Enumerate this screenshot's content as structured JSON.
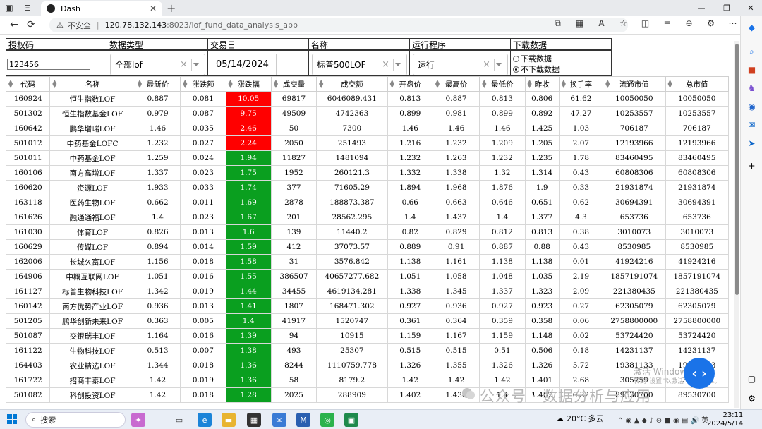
{
  "browser": {
    "tab_title": "Dash",
    "security_label": "不安全",
    "url_host": "120.78.132.143",
    "url_path": ":8023/lof_fund_data_analysis_app"
  },
  "controls": {
    "auth_label": "授权码",
    "auth_value": "123456",
    "datatype_label": "数据类型",
    "datatype_value": "全部lof",
    "date_label": "交易日",
    "date_value": "05/14/2024",
    "name_label": "名称",
    "name_value": "标普500LOF",
    "runner_label": "运行程序",
    "runner_value": "运行",
    "download_label": "下载数据",
    "download_options": [
      "下载数据",
      "不下载数据"
    ],
    "download_selected": "不下载数据"
  },
  "table": {
    "headers": [
      "代码",
      "名称",
      "最新价",
      "涨跌额",
      "涨跌幅",
      "成交量",
      "成交额",
      "开盘价",
      "最高价",
      "最低价",
      "昨收",
      "换手率",
      "流通市值",
      "总市值"
    ],
    "rows": [
      [
        "160924",
        "恒生指数LOF",
        "0.887",
        "0.081",
        "10.05",
        "69817",
        "6046089.431",
        "0.813",
        "0.887",
        "0.813",
        "0.806",
        "61.62",
        "10050050",
        "10050050"
      ],
      [
        "501302",
        "恒生指数基金LOF",
        "0.979",
        "0.087",
        "9.75",
        "49509",
        "4742363",
        "0.899",
        "0.981",
        "0.899",
        "0.892",
        "47.27",
        "10253557",
        "10253557"
      ],
      [
        "160642",
        "鹏华增瑞LOF",
        "1.46",
        "0.035",
        "2.46",
        "50",
        "7300",
        "1.46",
        "1.46",
        "1.46",
        "1.425",
        "1.03",
        "706187",
        "706187"
      ],
      [
        "501012",
        "中药基金LOFC",
        "1.232",
        "0.027",
        "2.24",
        "2050",
        "251493",
        "1.216",
        "1.232",
        "1.209",
        "1.205",
        "2.07",
        "12193966",
        "12193966"
      ],
      [
        "501011",
        "中药基金LOF",
        "1.259",
        "0.024",
        "1.94",
        "11827",
        "1481094",
        "1.232",
        "1.263",
        "1.232",
        "1.235",
        "1.78",
        "83460495",
        "83460495"
      ],
      [
        "160106",
        "南方高增LOF",
        "1.337",
        "0.023",
        "1.75",
        "1952",
        "260121.3",
        "1.332",
        "1.338",
        "1.32",
        "1.314",
        "0.43",
        "60808306",
        "60808306"
      ],
      [
        "160620",
        "资源LOF",
        "1.933",
        "0.033",
        "1.74",
        "377",
        "71605.29",
        "1.894",
        "1.968",
        "1.876",
        "1.9",
        "0.33",
        "21931874",
        "21931874"
      ],
      [
        "163118",
        "医药生物LOF",
        "0.662",
        "0.011",
        "1.69",
        "2878",
        "188873.387",
        "0.66",
        "0.663",
        "0.646",
        "0.651",
        "0.62",
        "30694391",
        "30694391"
      ],
      [
        "161626",
        "融通通福LOF",
        "1.4",
        "0.023",
        "1.67",
        "201",
        "28562.295",
        "1.4",
        "1.437",
        "1.4",
        "1.377",
        "4.3",
        "653736",
        "653736"
      ],
      [
        "161030",
        "体育LOF",
        "0.826",
        "0.013",
        "1.6",
        "139",
        "11440.2",
        "0.82",
        "0.829",
        "0.812",
        "0.813",
        "0.38",
        "3010073",
        "3010073"
      ],
      [
        "160629",
        "传媒LOF",
        "0.894",
        "0.014",
        "1.59",
        "412",
        "37073.57",
        "0.889",
        "0.91",
        "0.887",
        "0.88",
        "0.43",
        "8530985",
        "8530985"
      ],
      [
        "162006",
        "长城久富LOF",
        "1.156",
        "0.018",
        "1.58",
        "31",
        "3576.842",
        "1.138",
        "1.161",
        "1.138",
        "1.138",
        "0.01",
        "41924216",
        "41924216"
      ],
      [
        "164906",
        "中概互联网LOF",
        "1.051",
        "0.016",
        "1.55",
        "386507",
        "40657277.682",
        "1.051",
        "1.058",
        "1.048",
        "1.035",
        "2.19",
        "1857191074",
        "1857191074"
      ],
      [
        "161127",
        "标普生物科技LOF",
        "1.342",
        "0.019",
        "1.44",
        "34455",
        "4619134.281",
        "1.338",
        "1.345",
        "1.337",
        "1.323",
        "2.09",
        "221380435",
        "221380435"
      ],
      [
        "160142",
        "南方优势产业LOF",
        "0.936",
        "0.013",
        "1.41",
        "1807",
        "168471.302",
        "0.927",
        "0.936",
        "0.927",
        "0.923",
        "0.27",
        "62305079",
        "62305079"
      ],
      [
        "501205",
        "鹏华创新未来LOF",
        "0.363",
        "0.005",
        "1.4",
        "41917",
        "1520747",
        "0.361",
        "0.364",
        "0.359",
        "0.358",
        "0.06",
        "2758800000",
        "2758800000"
      ],
      [
        "501087",
        "交银瑞丰LOF",
        "1.164",
        "0.016",
        "1.39",
        "94",
        "10915",
        "1.159",
        "1.167",
        "1.159",
        "1.148",
        "0.02",
        "53724420",
        "53724420"
      ],
      [
        "161122",
        "生物科技LOF",
        "0.513",
        "0.007",
        "1.38",
        "493",
        "25307",
        "0.515",
        "0.515",
        "0.51",
        "0.506",
        "0.18",
        "14231137",
        "14231137"
      ],
      [
        "164403",
        "农业精选LOF",
        "1.344",
        "0.018",
        "1.36",
        "8244",
        "1110759.778",
        "1.326",
        "1.355",
        "1.326",
        "1.326",
        "5.72",
        "19381133",
        "19381133"
      ],
      [
        "161722",
        "招商丰泰LOF",
        "1.42",
        "0.019",
        "1.36",
        "58",
        "8179.2",
        "1.42",
        "1.42",
        "1.42",
        "1.401",
        "2.68",
        "305759",
        "305759"
      ],
      [
        "501082",
        "科创投资LOF",
        "1.42",
        "0.018",
        "1.28",
        "2025",
        "288909",
        "1.402",
        "1.436",
        "1.4",
        "1.402",
        "0.32",
        "89530700",
        "89530700"
      ]
    ]
  },
  "overlay": {
    "watermark": "公众号 · 数据分析与应用",
    "activate_line1": "激活 Windows",
    "activate_line2": "转到\"设置\"以激活 Windows。"
  },
  "taskbar": {
    "search_label": "搜索",
    "weather": "20°C 多云",
    "ime": "英",
    "time": "23:11",
    "date": "2024/5/14"
  },
  "colors": {
    "positive_strong": "#ff0000",
    "positive": "#0a9f1f"
  }
}
